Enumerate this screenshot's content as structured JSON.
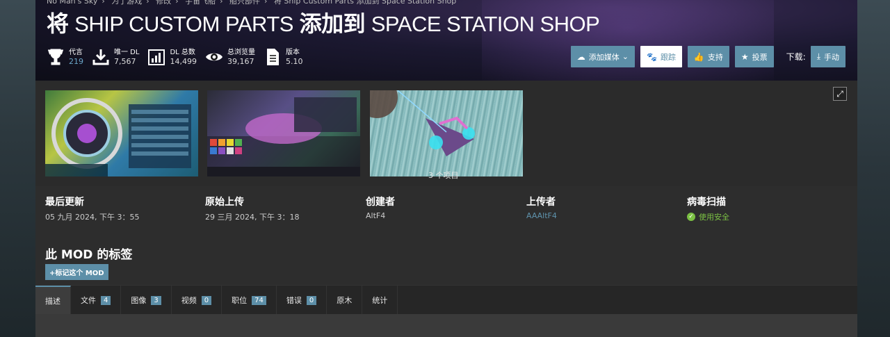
{
  "breadcrumb": [
    "No Man's Sky",
    "为了游戏",
    "修改",
    "宇宙飞船",
    "船只部件",
    "将 Ship Custom Parts 添加到 Space Station Shop"
  ],
  "title": {
    "part1": "将",
    "part2": "SHIP CUSTOM PARTS",
    "part3": "添加到",
    "part4": "SPACE STATION SHOP"
  },
  "stats": [
    {
      "label": "代言",
      "value": "219",
      "icon": "trophy-icon"
    },
    {
      "label": "唯一 DL",
      "value": "7,567",
      "icon": "download-icon"
    },
    {
      "label": "DL 总数",
      "value": "14,499",
      "icon": "bar-chart-icon"
    },
    {
      "label": "总浏览量",
      "value": "39,167",
      "icon": "eye-icon"
    },
    {
      "label": "版本",
      "value": "5.10",
      "icon": "document-icon"
    }
  ],
  "actions": {
    "add_media": "添加媒体",
    "track": "跟踪",
    "endorse": "支持",
    "vote": "投票",
    "download_label": "下载:",
    "manual": "手动"
  },
  "gallery": {
    "caption": "3 个项目"
  },
  "info": {
    "last_updated_label": "最后更新",
    "last_updated": "05 九月 2024, 下午 3：55",
    "original_upload_label": "原始上传",
    "original_upload": "29 三月 2024, 下午 3：18",
    "created_by_label": "创建者",
    "created_by": "AltF4",
    "uploaded_by_label": "上传者",
    "uploaded_by": "AAAltF4",
    "virus_scan_label": "病毒扫描",
    "virus_scan": "使用安全"
  },
  "tags": {
    "heading": "此 MOD 的标签",
    "button": "+标记这个 MOD"
  },
  "tabs": [
    {
      "label": "描述",
      "count": null
    },
    {
      "label": "文件",
      "count": "4"
    },
    {
      "label": "图像",
      "count": "3"
    },
    {
      "label": "视频",
      "count": "0"
    },
    {
      "label": "职位",
      "count": "74"
    },
    {
      "label": "错误",
      "count": "0"
    },
    {
      "label": "原木",
      "count": null
    },
    {
      "label": "统计",
      "count": null
    }
  ],
  "colors": {
    "accent": "#5d8fa8",
    "safe": "#7bc043"
  }
}
